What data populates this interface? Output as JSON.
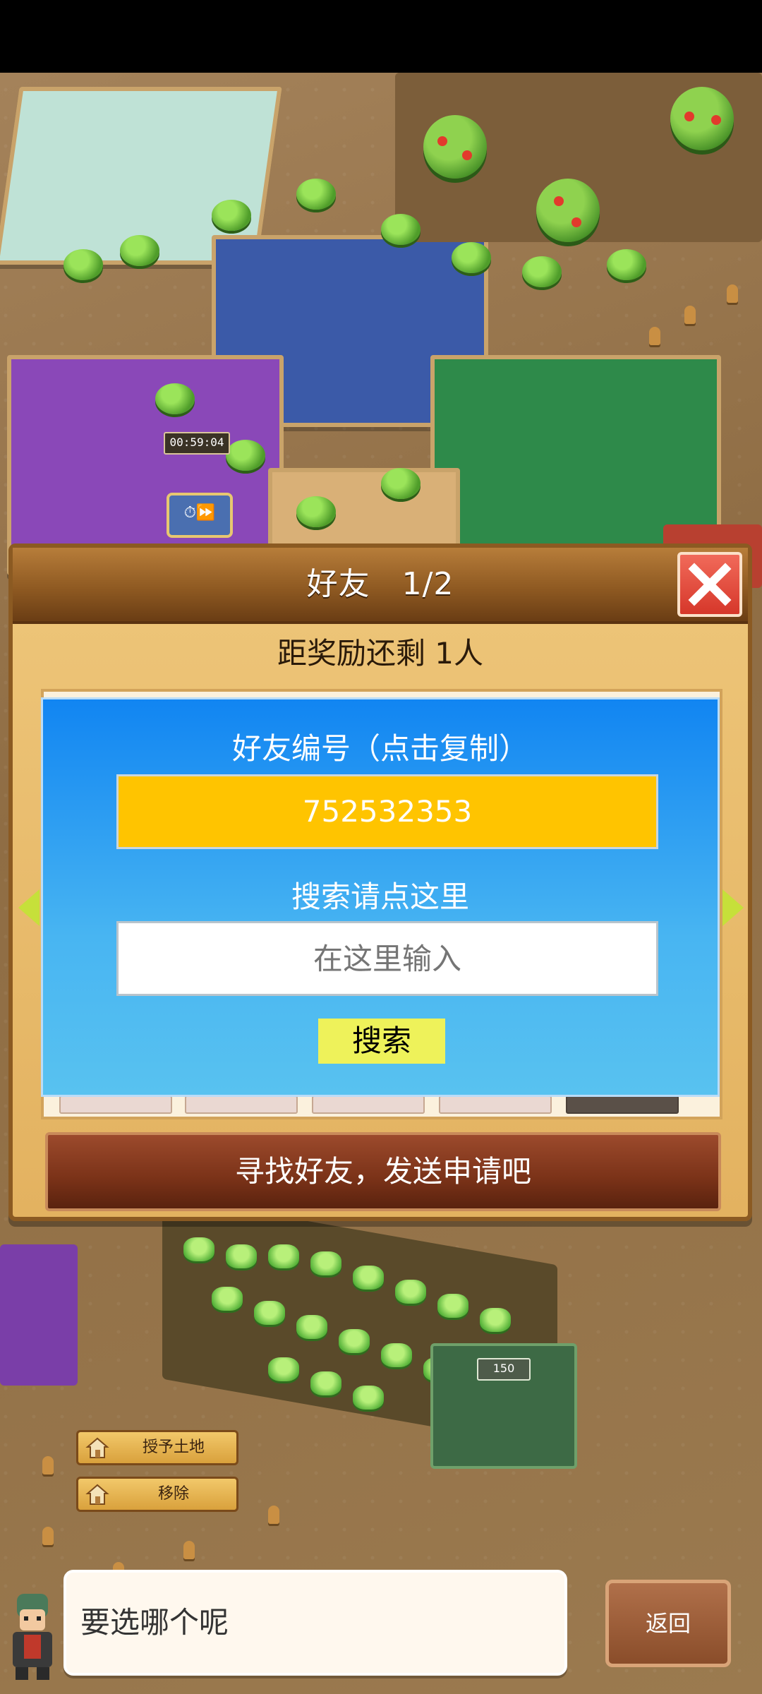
{
  "friend_dialog": {
    "title": "好友　1/2",
    "reward_status": "距奖励还剩 1人",
    "friend_id_label": "好友编号（点击复制）",
    "friend_id_value": "752532353",
    "search_label": "搜索请点这里",
    "search_placeholder": "在这里输入",
    "search_button": "搜索",
    "find_friends_button": "寻找好友，发送申请吧"
  },
  "game": {
    "timer": "00:59:04",
    "plot_value": "150",
    "context_buttons": [
      "授予土地",
      "移除"
    ]
  },
  "dialog_bar": {
    "message": "要选哪个呢",
    "back_button": "返回"
  },
  "colors": {
    "dialog_bg": "#e3b260",
    "header_bg": "#8f5a22",
    "id_box": "#ffc400",
    "panel_blue": "#1185f2",
    "search_button": "#eef25a",
    "close_red": "#d6372a"
  },
  "icons": [
    "close-icon",
    "arrow-left-icon",
    "arrow-right-icon",
    "stopwatch-icon",
    "fast-forward-icon",
    "house-icon",
    "character-avatar"
  ]
}
